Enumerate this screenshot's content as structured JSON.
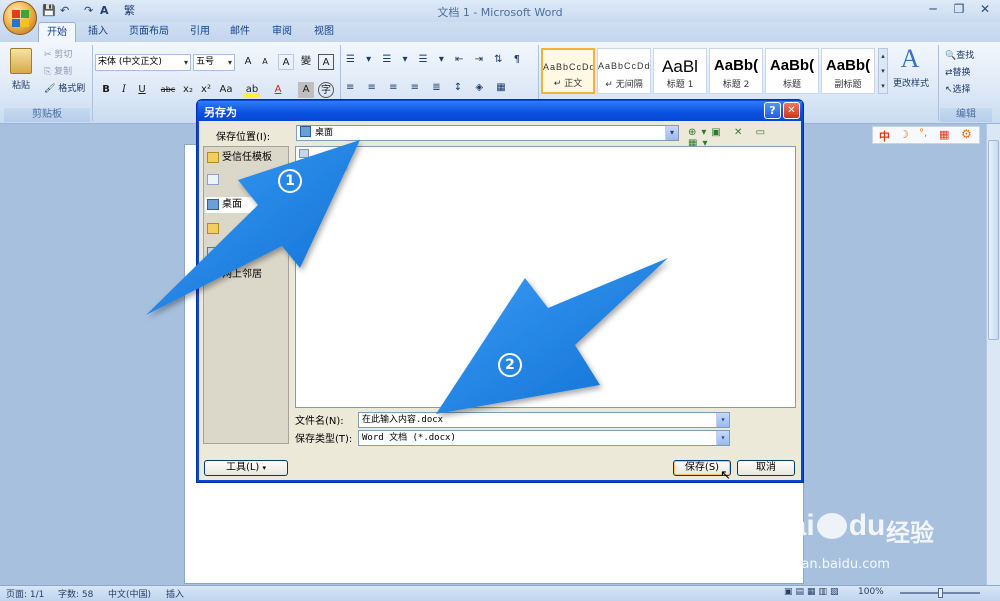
{
  "window": {
    "title": "文档 1 - Microsoft Word",
    "quick_access": [
      "💾",
      "↶",
      "↷",
      "A",
      "繁"
    ],
    "min": "─",
    "restore": "❐",
    "close": "✕"
  },
  "tabs": [
    {
      "label": "开始",
      "active": true
    },
    {
      "label": "插入"
    },
    {
      "label": "页面布局"
    },
    {
      "label": "引用"
    },
    {
      "label": "邮件"
    },
    {
      "label": "审阅"
    },
    {
      "label": "视图"
    }
  ],
  "ribbon": {
    "clipboard": {
      "paste": "粘贴",
      "cut": "剪切",
      "copy": "复制",
      "format_painter": "格式刷",
      "label": "剪贴板"
    },
    "font": {
      "name": "宋体 (中文正文)",
      "size": "五号",
      "grow": "A",
      "shrink": "A",
      "clear": "A",
      "phonetic": "變",
      "border": "A",
      "bold": "B",
      "italic": "I",
      "underline": "U",
      "strike": "abc",
      "sub": "x₂",
      "sup": "x²",
      "case": "Aa",
      "highlight": "ab",
      "color": "A",
      "shade": "A",
      "enclose": "字"
    },
    "styles": [
      {
        "sample": "AaBbCcDd",
        "name": "↵ 正文",
        "small": true,
        "selected": true
      },
      {
        "sample": "AaBbCcDd",
        "name": "↵ 无间隔",
        "small": true
      },
      {
        "sample": "AaBl",
        "name": "标题 1"
      },
      {
        "sample": "AaBb(",
        "name": "标题 2"
      },
      {
        "sample": "AaBb(",
        "name": "标题"
      },
      {
        "sample": "AaBb(",
        "name": "副标题"
      }
    ],
    "change_styles": "更改样式",
    "editing": {
      "find": "查找",
      "replace": "替换",
      "select": "选择",
      "label": "编辑"
    }
  },
  "ime": [
    "中",
    "☽",
    "°,",
    "▦",
    "⚙"
  ],
  "dialog": {
    "title": "另存为",
    "help": "?",
    "close": "✕",
    "save_in_label": "保存位置(I):",
    "save_in_value": "桌面",
    "places": [
      {
        "label": "受信任模板"
      },
      {
        "label": ""
      },
      {
        "label": "桌面"
      },
      {
        "label": ""
      },
      {
        "label": ""
      },
      {
        "label": "网上邻居"
      }
    ],
    "file_list_items": [
      "",
      ""
    ],
    "filename_label": "文件名(N):",
    "filename_value": "在此输入内容.docx",
    "filetype_label": "保存类型(T):",
    "filetype_value": "Word 文档 (*.docx)",
    "tools_button": "工具(L)",
    "save_button": "保存(S)",
    "cancel_button": "取消"
  },
  "annotations": {
    "step1": "1",
    "step2": "2",
    "arrow_color": "#1f86e8"
  },
  "status": {
    "page": "页面: 1/1",
    "words": "字数: 58",
    "lang": "中文(中国)",
    "insert": "插入",
    "zoom": "100%"
  },
  "watermark": {
    "brand_left": "Bai",
    "brand_right": "du",
    "brand_cn": "经验",
    "url": "jingyan.baidu.com"
  }
}
